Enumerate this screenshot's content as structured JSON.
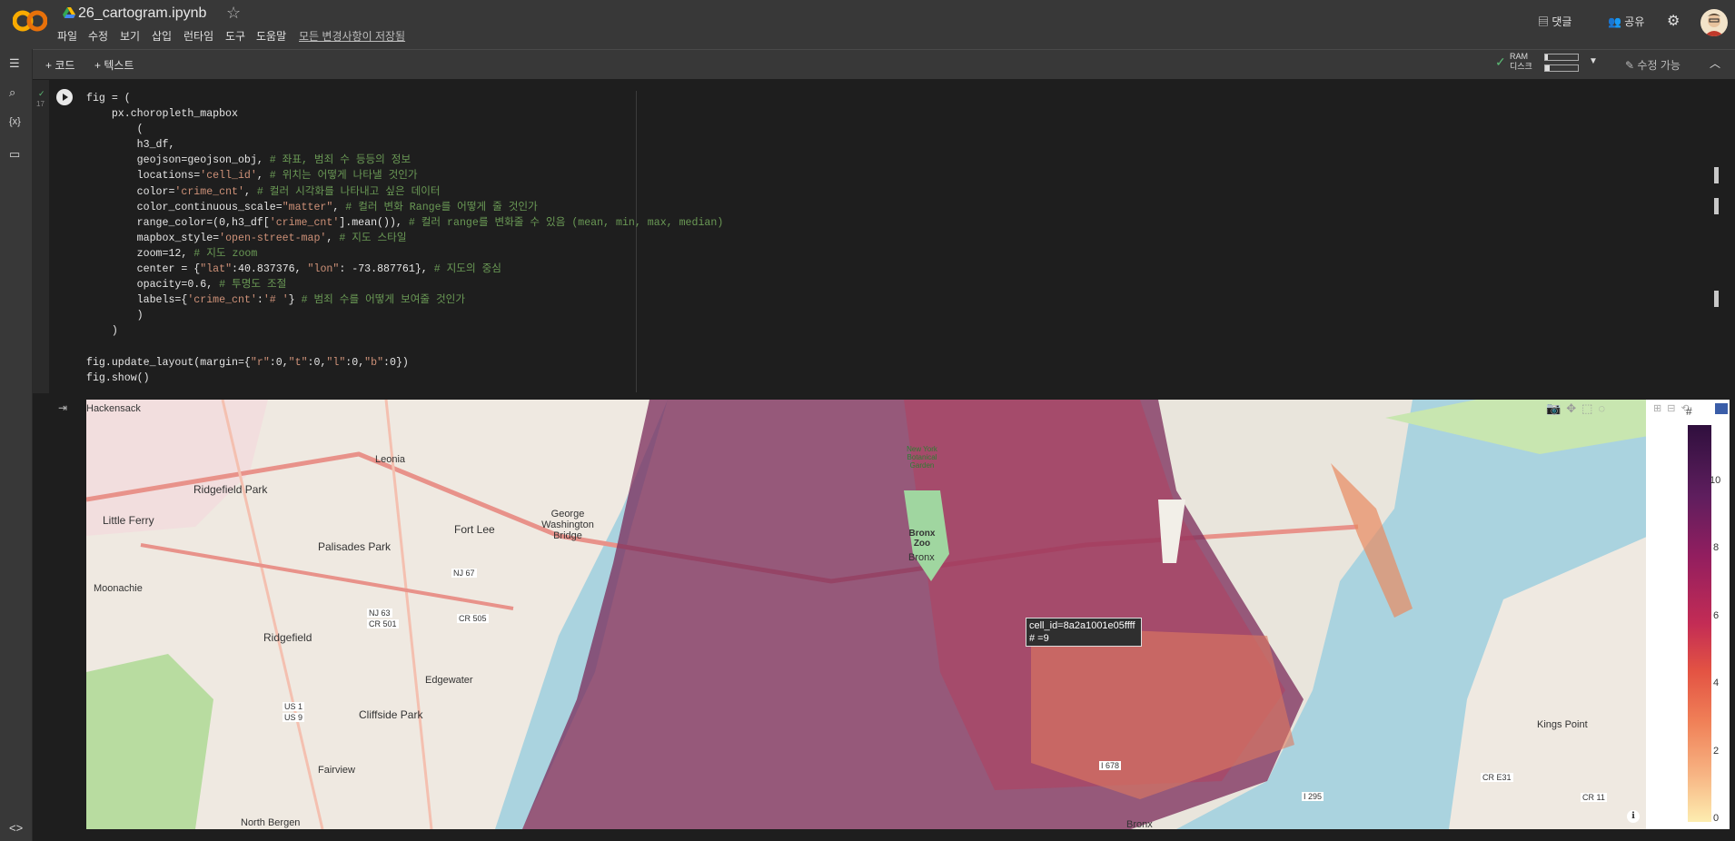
{
  "header": {
    "notebook_title": "26_cartogram.ipynb",
    "menus": [
      "파일",
      "수정",
      "보기",
      "삽입",
      "런타임",
      "도구",
      "도움말"
    ],
    "saved_status": "모든 변경사항이 저장됨",
    "comments_label": "댓글",
    "share_label": "공유"
  },
  "toolbar": {
    "add_code": "+ 코드",
    "add_text": "+ 텍스트",
    "ram_label": "RAM",
    "disk_label": "디스크",
    "edit_mode": "수정 가능"
  },
  "cell": {
    "exec_count": "17",
    "lines": [
      "fig = (",
      "    px.choropleth_mapbox",
      "        (",
      "        h3_df,",
      "        geojson=geojson_obj, # 좌표, 범죄 수 등등의 정보",
      "        locations='cell_id', # 위치는 어떻게 나타낼 것인가",
      "        color='crime_cnt', # 컬러 시각화를 나타내고 싶은 데이터",
      "        color_continuous_scale=\"matter\", # 컬러 변화 Range를 어떻게 줄 것인가",
      "        range_color=(0,h3_df['crime_cnt'].mean()), # 컬러 range를 변화줄 수 있음 (mean, min, max, median)",
      "        mapbox_style='open-street-map', # 지도 스타일",
      "        zoom=12, # 지도 zoom",
      "        center = {\"lat\":40.837376, \"lon\": -73.887761}, # 지도의 중심",
      "        opacity=0.6, # 투명도 조절",
      "        labels={'crime_cnt':'# '} # 범죄 수를 어떻게 보여줄 것인가",
      "        )",
      "    )",
      "",
      "fig.update_layout(margin={\"r\":0,\"t\":0,\"l\":0,\"b\":0})",
      "fig.show()"
    ]
  },
  "map": {
    "tooltip_line1": "cell_id=8a2a1001e05ffff",
    "tooltip_line2": "# =9",
    "colorbar_title": "#",
    "colorbar_ticks": [
      "10",
      "8",
      "6",
      "4",
      "2",
      "0"
    ],
    "place_labels": [
      "Hackensack",
      "Leonia",
      "Ridgefield Park",
      "Little Ferry",
      "Palisades Park",
      "Fort Lee",
      "George Washington Bridge",
      "Moonachie",
      "Ridgefield",
      "NJ 67",
      "NJ 63",
      "CR 501",
      "CR 505",
      "Edgewater",
      "US 1",
      "US 9",
      "Cliffside Park",
      "Fairview",
      "North Bergen",
      "New York Botanical Garden",
      "Bronx Zoo",
      "Bronx",
      "Kings Point",
      "CR E31",
      "CR 11",
      "I 678",
      "I 295",
      "Bronx"
    ]
  }
}
